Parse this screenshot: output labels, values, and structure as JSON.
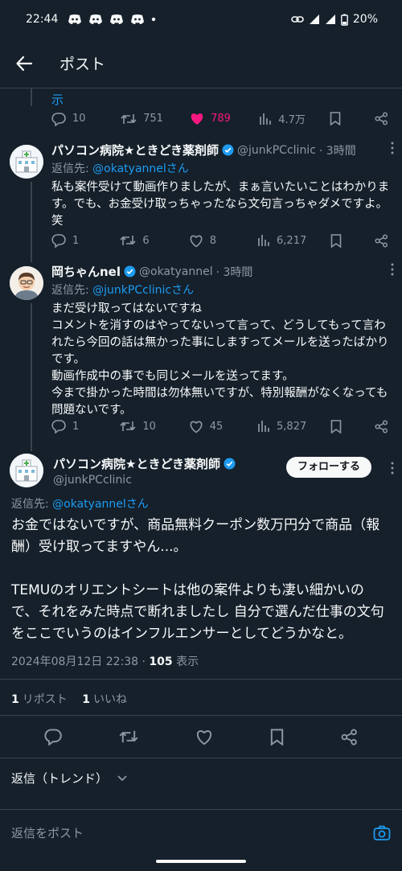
{
  "status_bar": {
    "time": "22:44",
    "battery": "20%"
  },
  "header": {
    "title": "ポスト"
  },
  "prev_tweet": {
    "text_tail": "示",
    "replies": "10",
    "retweets": "751",
    "likes": "789",
    "views": "4.7万"
  },
  "tweets": [
    {
      "name": "パソコン病院★ときどき薬剤師",
      "handle": "@junkPCclinic",
      "time": "· 3時間",
      "reply_prefix": "返信先: ",
      "reply_to": "@okatyannelさん",
      "body": "私も案件受けて動画作りましたが、まぁ言いたいことはわかります。でも、お金受け取っちゃったなら文句言っちゃダメですよ。笑",
      "replies": "1",
      "retweets": "6",
      "likes": "8",
      "views": "6,217"
    },
    {
      "name": "岡ちゃんnel",
      "handle": "@okatyannel",
      "time": "· 3時間",
      "reply_prefix": "返信先: ",
      "reply_to": "@junkPCclinicさん",
      "body": "まだ受け取ってはないですね\nコメントを消すのはやってないって言って、どうしてもって言われたら今回の話は無かった事にしますってメールを送ったばかりです。\n動画作成中の事でも同じメールを送ってます。\n今まで掛かった時間は勿体無いですが、特別報酬がなくなっても問題ないです。",
      "replies": "1",
      "retweets": "10",
      "likes": "45",
      "views": "5,827"
    }
  ],
  "main_tweet": {
    "name": "パソコン病院★ときどき薬剤師",
    "handle": "@junkPCclinic",
    "follow_label": "フォローする",
    "reply_prefix": "返信先: ",
    "reply_to": "@okatyannelさん",
    "body": "お金ではないですが、商品無料クーポン数万円分で商品（報酬）受け取ってますやん...。\n\nTEMUのオリエントシートは他の案件よりも凄い細かいので、それをみた時点で断れましたし 自分で選んだ仕事の文句をここでいうのはインフルエンサーとしてどうかなと。",
    "datetime": "2024年08月12日 22:38 · ",
    "views_count": "105",
    "views_label": " 表示",
    "reposts_count": "1",
    "reposts_label": "リポスト",
    "likes_count": "1",
    "likes_label": "いいね"
  },
  "trend_label": "返信（トレンド）",
  "compose_placeholder": "返信をポスト",
  "colors": {
    "background": "#15202b",
    "accent": "#1d9bf0",
    "like": "#f91880",
    "muted": "#8b98a5"
  }
}
